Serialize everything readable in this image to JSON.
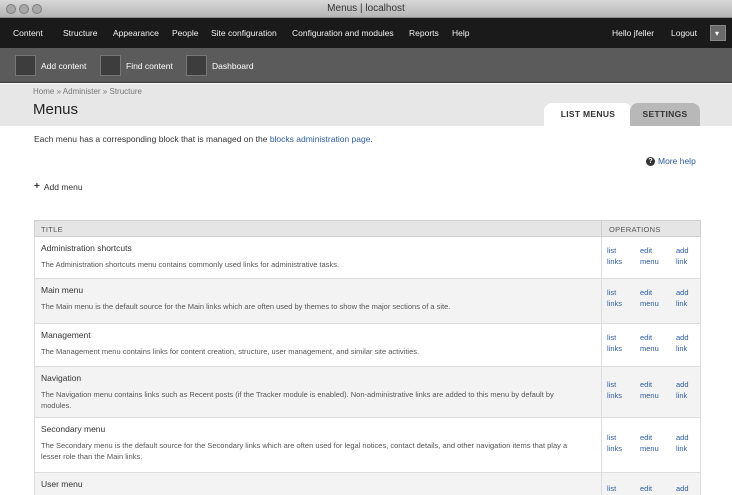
{
  "window": {
    "title": "Menus | localhost"
  },
  "toolbar": {
    "nav": [
      "Content",
      "Structure",
      "Appearance",
      "People",
      "Site configuration",
      "Configuration and modules",
      "Reports",
      "Help"
    ],
    "user_greeting": "Hello jfeller",
    "logout": "Logout",
    "toggle_icon": "chevron-down-icon"
  },
  "shortcuts": [
    "Add content",
    "Find content",
    "Dashboard"
  ],
  "header": {
    "breadcrumb": "Home » Administer » Structure",
    "title": "Menus",
    "tabs": [
      "LIST MENUS",
      "SETTINGS"
    ]
  },
  "intro": {
    "text_before": "Each menu has a corresponding block that is managed on the",
    "link": "blocks administration page",
    "text_after": "."
  },
  "more_help": "More help",
  "add_menu": "Add menu",
  "table": {
    "columns": [
      "TITLE",
      "OPERATIONS"
    ],
    "operations": [
      "list links",
      "edit menu",
      "add link"
    ],
    "rows": [
      {
        "name": "Administration shortcuts",
        "desc": "The Administration shortcuts menu contains commonly used links for administrative tasks."
      },
      {
        "name": "Main menu",
        "desc": "The Main menu is the default source for the Main links which are often used by themes to show the major sections of a site."
      },
      {
        "name": "Management",
        "desc": "The Management menu contains links for content creation, structure, user management, and similar site activities."
      },
      {
        "name": "Navigation",
        "desc": "The Navigation menu contains links such as Recent posts (if the Tracker module is enabled). Non-administrative links are added to this menu by default by modules."
      },
      {
        "name": "Secondary menu",
        "desc": "The Secondary menu is the default source for the Secondary links which are often used for legal notices, contact details, and other navigation items that play a lesser role than the Main links."
      },
      {
        "name": "User menu",
        "desc": ""
      }
    ]
  },
  "colors": {
    "link": "#2c5ba0",
    "toolbar": "#1a1a1a",
    "shortcut_bar": "#5b5b5b"
  }
}
